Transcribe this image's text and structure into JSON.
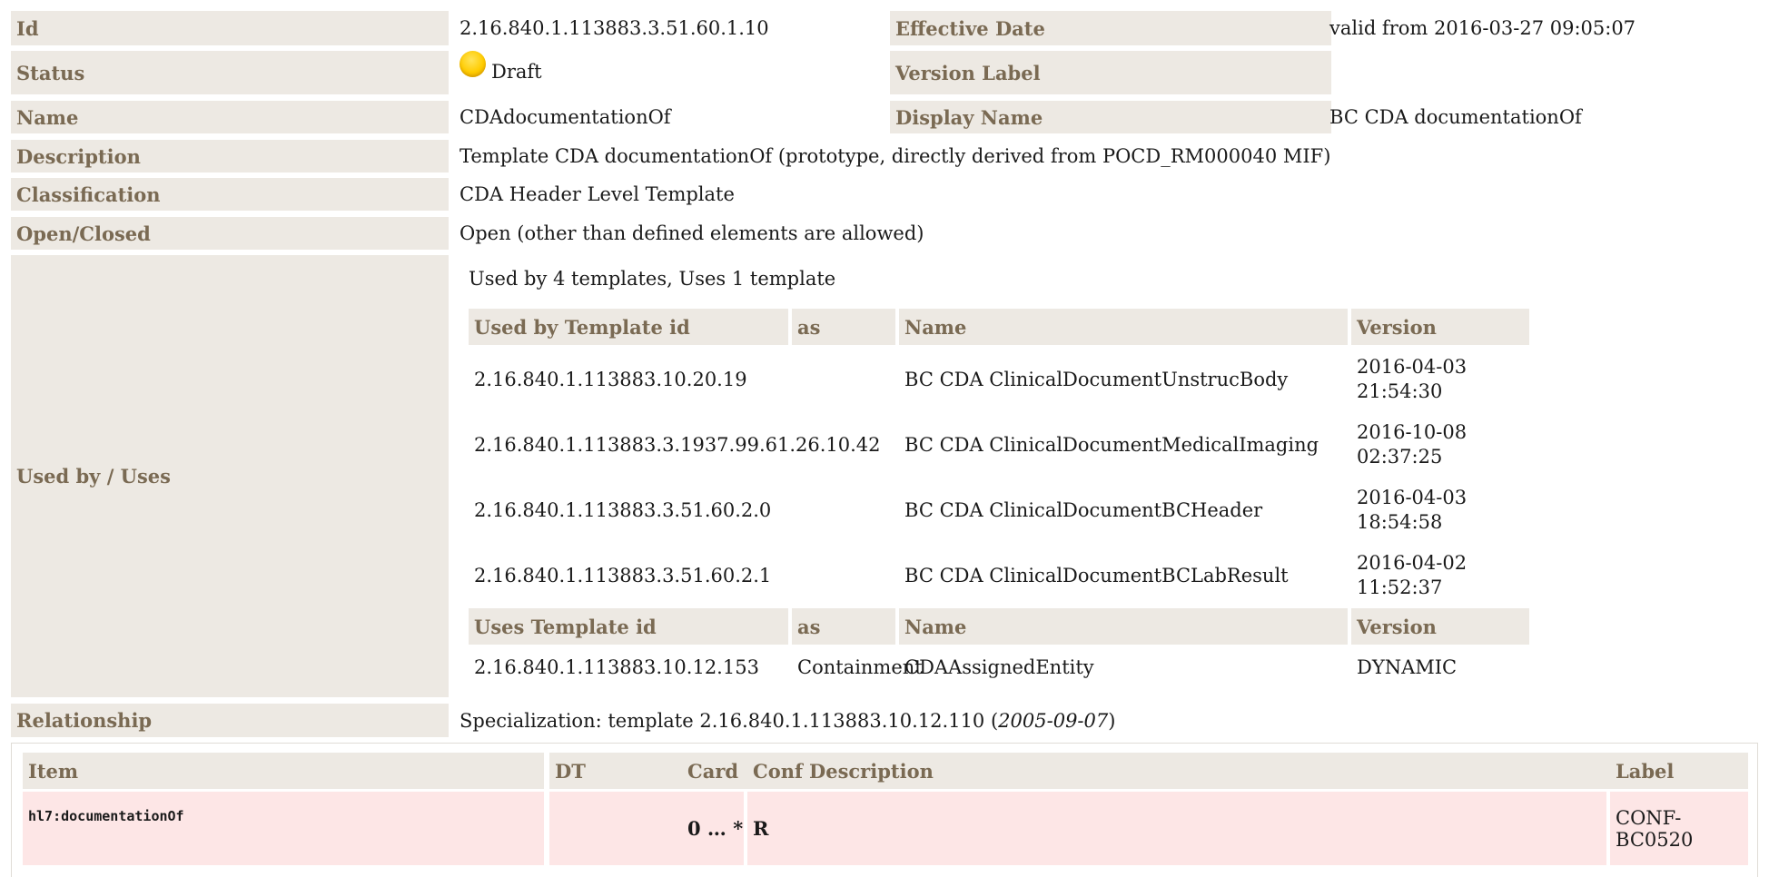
{
  "meta": {
    "id_label": "Id",
    "id_value": "2.16.840.1.113883.3.51.60.1.10",
    "effective_label": "Effective Date",
    "effective_value": "valid from 2016-03-27 09:05:07",
    "status_label": "Status",
    "status_value": "Draft",
    "version_label": "Version Label",
    "version_value": "",
    "name_label": "Name",
    "name_value": "CDAdocumentationOf",
    "display_label": "Display Name",
    "display_value": "BC CDA documentationOf",
    "description_label": "Description",
    "description_value": "Template CDA documentationOf (prototype, directly derived from POCD_RM000040 MIF)",
    "classification_label": "Classification",
    "classification_value": "CDA Header Level Template",
    "openclosed_label": "Open/Closed",
    "openclosed_value": "Open (other than defined elements are allowed)",
    "usedby_label": "Used by / Uses",
    "relationship_label": "Relationship",
    "relationship_prefix": "Specialization: template 2.16.840.1.113883.10.12.110 (",
    "relationship_date": "2005-09-07",
    "relationship_suffix": ")"
  },
  "status_color": "#ffcc00",
  "usage": {
    "summary": "Used by 4 templates, Uses 1 template",
    "usedby_headers": [
      "Used by Template id",
      "as",
      "Name",
      "Version"
    ],
    "usedby_rows": [
      {
        "id": "2.16.840.1.113883.10.20.19",
        "as": "",
        "name": "BC CDA ClinicalDocumentUnstrucBody",
        "version_date": "2016-04-03",
        "version_time": "21:54:30"
      },
      {
        "id": "2.16.840.1.113883.3.1937.99.61.26.10.42",
        "as": "",
        "name": "BC CDA ClinicalDocumentMedicalImaging",
        "version_date": "2016-10-08",
        "version_time": "02:37:25"
      },
      {
        "id": "2.16.840.1.113883.3.51.60.2.0",
        "as": "",
        "name": "BC CDA ClinicalDocumentBCHeader",
        "version_date": "2016-04-03",
        "version_time": "18:54:58"
      },
      {
        "id": "2.16.840.1.113883.3.51.60.2.1",
        "as": "",
        "name": "BC CDA ClinicalDocumentBCLabResult",
        "version_date": "2016-04-02",
        "version_time": "11:52:37"
      }
    ],
    "uses_headers": [
      "Uses Template id",
      "as",
      "Name",
      "Version"
    ],
    "uses_rows": [
      {
        "id": "2.16.840.1.113883.10.12.153",
        "as": "Containment",
        "name": "CDAAssignedEntity",
        "version": "DYNAMIC"
      }
    ]
  },
  "items": {
    "headers": {
      "item": "Item",
      "dt": "DT",
      "card": "Card",
      "conf": "Conf",
      "description": "Description",
      "label": "Label"
    },
    "rows": [
      {
        "item": "hl7:documentationOf",
        "dt": "",
        "card": "0 … *",
        "conf": "R",
        "description": "",
        "label": "CONF-BC0520"
      }
    ]
  }
}
